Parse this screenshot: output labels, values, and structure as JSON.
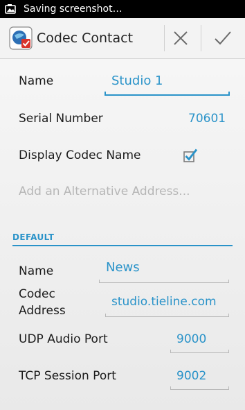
{
  "status_bar": {
    "notification_icon": "screenshot-icon",
    "text": "Saving screenshot…"
  },
  "action_bar": {
    "app_icon": "codec-contact-icon",
    "title": "Codec Contact",
    "cancel_icon": "close-icon",
    "confirm_icon": "checkmark-icon"
  },
  "contact": {
    "name_label": "Name",
    "name_value": "Studio 1",
    "serial_label": "Serial Number",
    "serial_value": "70601",
    "display_name_label": "Display Codec Name",
    "display_name_checked": true,
    "alt_address_placeholder": "Add an Alternative Address..."
  },
  "default_section": {
    "header": "DEFAULT",
    "name_label": "Name",
    "name_value": "News",
    "address_label": "Codec Address",
    "address_value": "studio.tieline.com",
    "udp_label": "UDP Audio Port",
    "udp_value": "9000",
    "tcp_label": "TCP Session Port",
    "tcp_value": "9002"
  },
  "colors": {
    "accent": "#2a93c9",
    "status_bar": "#000000",
    "action_bar": "#f3f3f3"
  }
}
